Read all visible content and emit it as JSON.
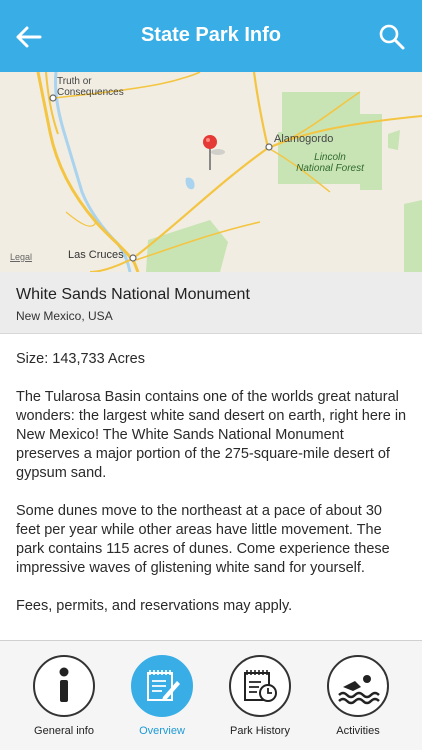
{
  "header": {
    "title": "State Park Info",
    "back_icon": "back-arrow-icon",
    "search_icon": "search-icon"
  },
  "map": {
    "places": {
      "truth": "Truth or Consequences",
      "alamogordo": "Alamogordo",
      "lincoln": "Lincoln National Forest",
      "las_cruces": "Las Cruces"
    },
    "legal": "Legal",
    "pin_icon": "map-pin-icon",
    "colors": {
      "land": "#f1ede2",
      "forest": "#c9e4b4",
      "road": "#f4c542",
      "water": "#a9d3ee",
      "pin": "#e53935"
    }
  },
  "park": {
    "name": "White Sands National Monument",
    "location": "New Mexico, USA"
  },
  "content": {
    "size": "Size: 143,733 Acres",
    "p1": "The Tularosa Basin contains one of the worlds great natural wonders: the largest white sand desert on earth, right here in New Mexico! The White Sands National Monument preserves a major portion of the 275-square-mile desert of gypsum sand.",
    "p2": "Some dunes move to the northeast at a pace of about 30 feet per year while other areas have little movement. The park contains 115 acres of dunes. Come experience these impressive waves of glistening white sand for yourself.",
    "p3": "Fees, permits, and reservations may apply."
  },
  "nav": {
    "items": [
      {
        "label": "General info",
        "icon": "info-icon",
        "active": false
      },
      {
        "label": "Overview",
        "icon": "notepad-icon",
        "active": true
      },
      {
        "label": "Park History",
        "icon": "history-icon",
        "active": false
      },
      {
        "label": "Activities",
        "icon": "swimmer-icon",
        "active": false
      }
    ],
    "accent": "#39aee6"
  }
}
